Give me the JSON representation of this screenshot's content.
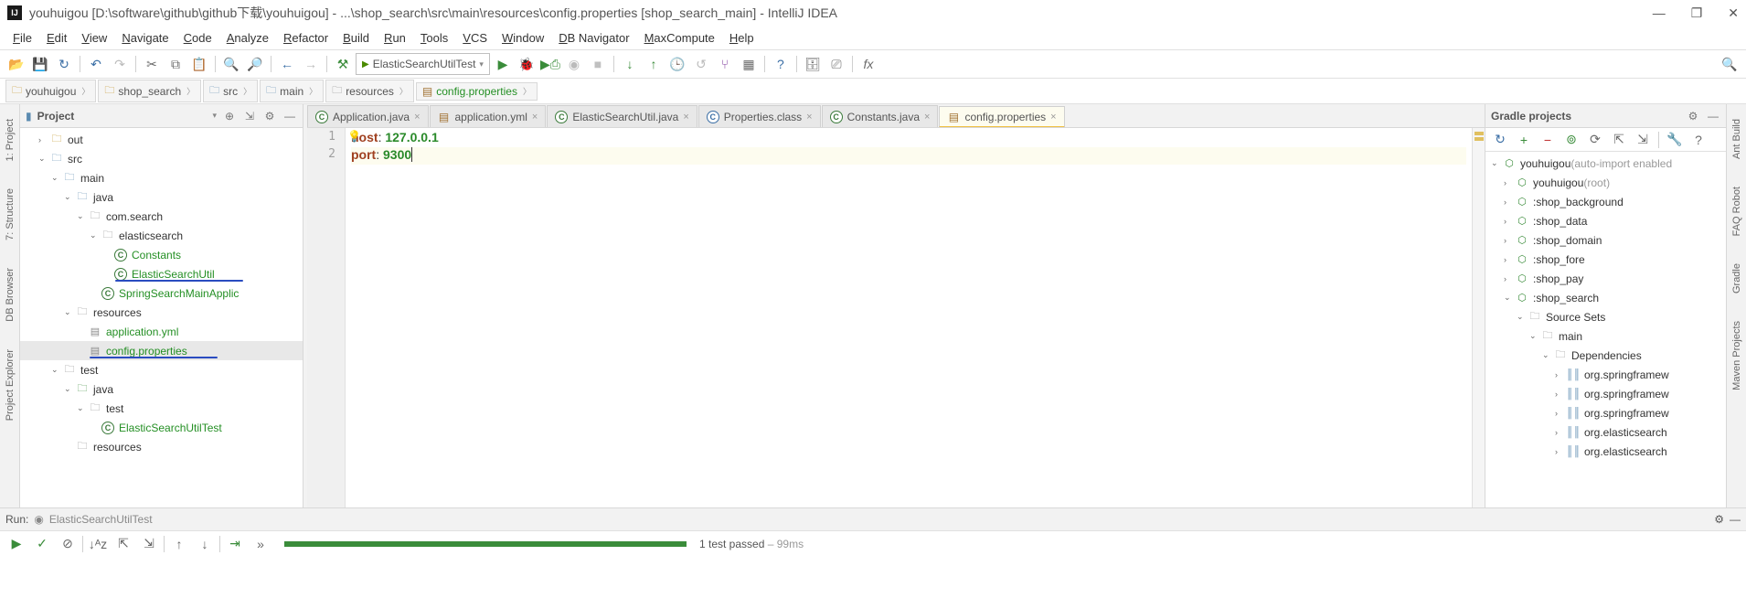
{
  "window": {
    "title": "youhuigou [D:\\software\\github\\github下载\\youhuigou] - ...\\shop_search\\src\\main\\resources\\config.properties [shop_search_main] - IntelliJ IDEA"
  },
  "menu": [
    "File",
    "Edit",
    "View",
    "Navigate",
    "Code",
    "Analyze",
    "Refactor",
    "Build",
    "Run",
    "Tools",
    "VCS",
    "Window",
    "DB Navigator",
    "MaxCompute",
    "Help"
  ],
  "run_config": "ElasticSearchUtilTest",
  "breadcrumbs": [
    {
      "label": "youhuigou",
      "kind": "folder"
    },
    {
      "label": "shop_search",
      "kind": "folder"
    },
    {
      "label": "src",
      "kind": "folder-blue"
    },
    {
      "label": "main",
      "kind": "folder-blue"
    },
    {
      "label": "resources",
      "kind": "folder-gray"
    },
    {
      "label": "config.properties",
      "kind": "file",
      "selected": true
    }
  ],
  "project_header": "Project",
  "project_tree": [
    {
      "indent": 10,
      "arrow": ">",
      "ico": "folder",
      "lbl": "out"
    },
    {
      "indent": 10,
      "arrow": "v",
      "ico": "folder-blue",
      "lbl": "src"
    },
    {
      "indent": 20,
      "arrow": "v",
      "ico": "folder-blue",
      "lbl": "main"
    },
    {
      "indent": 30,
      "arrow": "v",
      "ico": "folder-blue",
      "lbl": "java"
    },
    {
      "indent": 40,
      "arrow": "v",
      "ico": "folder-gray",
      "lbl": "com.search"
    },
    {
      "indent": 50,
      "arrow": "v",
      "ico": "folder-gray",
      "lbl": "elasticsearch"
    },
    {
      "indent": 60,
      "arrow": "",
      "ico": "class",
      "lbl": "Constants",
      "green": true
    },
    {
      "indent": 60,
      "arrow": "",
      "ico": "class",
      "lbl": "ElasticSearchUtil",
      "green": true,
      "underline": true
    },
    {
      "indent": 50,
      "arrow": "",
      "ico": "class",
      "lbl": "SpringSearchMainApplic",
      "green": true
    },
    {
      "indent": 30,
      "arrow": "v",
      "ico": "folder-gray",
      "lbl": "resources"
    },
    {
      "indent": 40,
      "arrow": "",
      "ico": "file",
      "lbl": "application.yml",
      "green": true
    },
    {
      "indent": 40,
      "arrow": "",
      "ico": "file",
      "lbl": "config.properties",
      "green": true,
      "sel": true,
      "underline": true
    },
    {
      "indent": 20,
      "arrow": "v",
      "ico": "folder-gray",
      "lbl": "test"
    },
    {
      "indent": 30,
      "arrow": "v",
      "ico": "folder",
      "lbl": "java",
      "foldergreen": true
    },
    {
      "indent": 40,
      "arrow": "v",
      "ico": "folder-gray",
      "lbl": "test"
    },
    {
      "indent": 50,
      "arrow": "",
      "ico": "class",
      "lbl": "ElasticSearchUtilTest",
      "green": true
    },
    {
      "indent": 30,
      "arrow": "",
      "ico": "folder-gray",
      "lbl": "resources"
    }
  ],
  "tabs": [
    {
      "label": "Application.java",
      "ico": "class"
    },
    {
      "label": "application.yml",
      "ico": "file"
    },
    {
      "label": "ElasticSearchUtil.java",
      "ico": "class"
    },
    {
      "label": "Properties.class",
      "ico": "class-blue"
    },
    {
      "label": "Constants.java",
      "ico": "class"
    },
    {
      "label": "config.properties",
      "ico": "file",
      "active": true
    }
  ],
  "editor": {
    "lines": [
      {
        "n": "1",
        "key": "host",
        "sep": ": ",
        "val": "127.0.0.1"
      },
      {
        "n": "2",
        "key": "port",
        "sep": ": ",
        "val": "9300",
        "current": true
      }
    ]
  },
  "gradle_header": "Gradle projects",
  "gradle_tree": [
    {
      "indent": 0,
      "arrow": "v",
      "ico": "gradle",
      "lbl": "youhuigou",
      "suffix": " (auto-import enabled"
    },
    {
      "indent": 10,
      "arrow": ">",
      "ico": "gradle",
      "lbl": "youhuigou",
      "suffix": " (root)"
    },
    {
      "indent": 10,
      "arrow": ">",
      "ico": "gradle",
      "lbl": ":shop_background"
    },
    {
      "indent": 10,
      "arrow": ">",
      "ico": "gradle",
      "lbl": ":shop_data"
    },
    {
      "indent": 10,
      "arrow": ">",
      "ico": "gradle",
      "lbl": ":shop_domain"
    },
    {
      "indent": 10,
      "arrow": ">",
      "ico": "gradle",
      "lbl": ":shop_fore"
    },
    {
      "indent": 10,
      "arrow": ">",
      "ico": "gradle",
      "lbl": ":shop_pay"
    },
    {
      "indent": 10,
      "arrow": "v",
      "ico": "gradle",
      "lbl": ":shop_search"
    },
    {
      "indent": 20,
      "arrow": "v",
      "ico": "folder-gray",
      "lbl": "Source Sets"
    },
    {
      "indent": 30,
      "arrow": "v",
      "ico": "folder-gray",
      "lbl": "main"
    },
    {
      "indent": 40,
      "arrow": "v",
      "ico": "folder-gray",
      "lbl": "Dependencies"
    },
    {
      "indent": 50,
      "arrow": ">",
      "ico": "lib",
      "lbl": "org.springframew"
    },
    {
      "indent": 50,
      "arrow": ">",
      "ico": "lib",
      "lbl": "org.springframew"
    },
    {
      "indent": 50,
      "arrow": ">",
      "ico": "lib",
      "lbl": "org.springframew"
    },
    {
      "indent": 50,
      "arrow": ">",
      "ico": "lib",
      "lbl": "org.elasticsearch"
    },
    {
      "indent": 50,
      "arrow": ">",
      "ico": "lib",
      "lbl": "org.elasticsearch"
    }
  ],
  "run_panel": {
    "label": "Run:",
    "config": "ElasticSearchUtilTest"
  },
  "status": {
    "passed": "1 test passed",
    "time": " – 99ms",
    "progress_pct": 100
  },
  "left_rails": [
    "1: Project",
    "7: Structure",
    "DB Browser",
    "Project Explorer"
  ],
  "right_rails": [
    "Ant Build",
    "FAQ Robot",
    "Gradle",
    "Maven Projects"
  ]
}
